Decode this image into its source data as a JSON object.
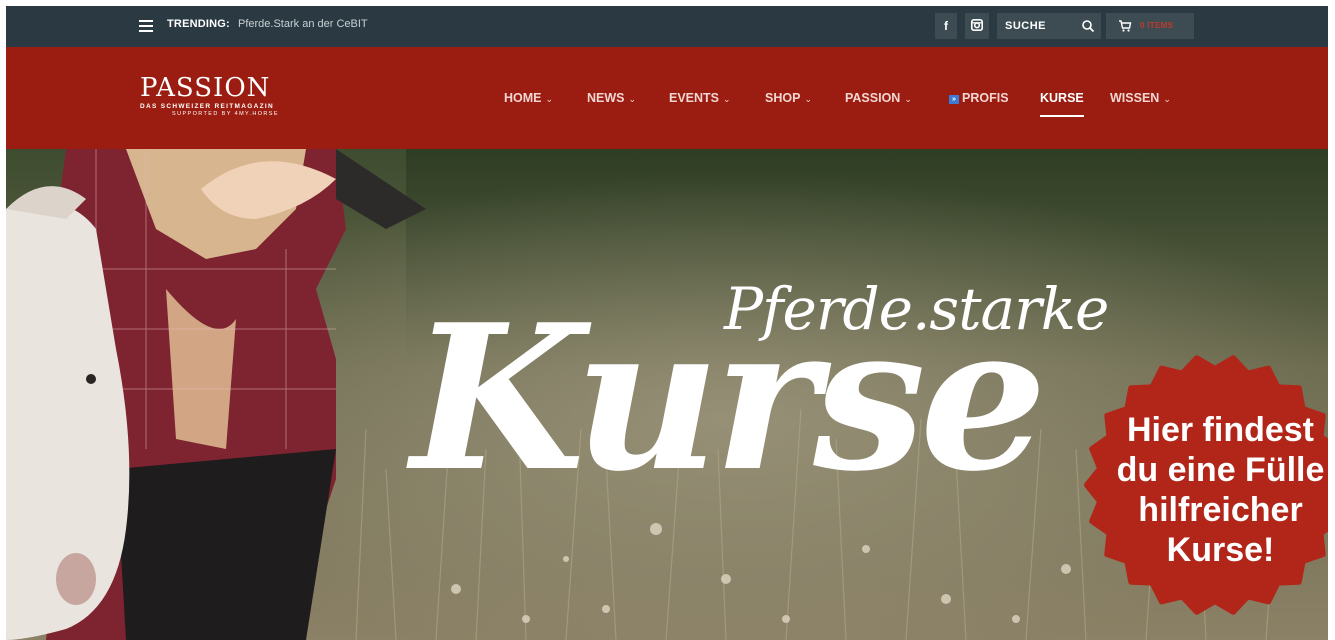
{
  "topbar": {
    "trending_label": "TRENDING:",
    "trending_text": "Pferde.Stark an der CeBIT",
    "facebook_glyph": "f",
    "search_placeholder": "SUCHE",
    "cart_label": "0 ITEMS"
  },
  "logo": {
    "name": "PASSION",
    "tagline": "DAS SCHWEIZER REITMAGAZIN",
    "supported": "SUPPORTED BY 4MY.HORSE"
  },
  "nav": {
    "items": [
      {
        "label": "HOME",
        "chevron": "⌄"
      },
      {
        "label": "NEWS",
        "chevron": "⌄"
      },
      {
        "label": "EVENTS",
        "chevron": "⌄"
      },
      {
        "label": "SHOP",
        "chevron": "⌄"
      },
      {
        "label": "PASSION",
        "chevron": "⌄"
      },
      {
        "label": "PROFIS"
      },
      {
        "label": "KURSE"
      },
      {
        "label": "WISSEN",
        "chevron": "⌄"
      }
    ],
    "active": "KURSE"
  },
  "hero": {
    "headline_small": "Pferde.starke",
    "headline_big": "Kurse",
    "badge_lines": [
      "Hier findest",
      "du eine Fülle",
      "hilfreicher",
      "Kurse!"
    ]
  },
  "colors": {
    "topbar": "#2b3a42",
    "header": "#9b1c10",
    "badge": "#b2261a",
    "profis_icon": "#3a7bd5"
  },
  "icons": [
    "menu-icon",
    "facebook-icon",
    "instagram-icon",
    "search-icon",
    "cart-icon",
    "play-icon"
  ]
}
